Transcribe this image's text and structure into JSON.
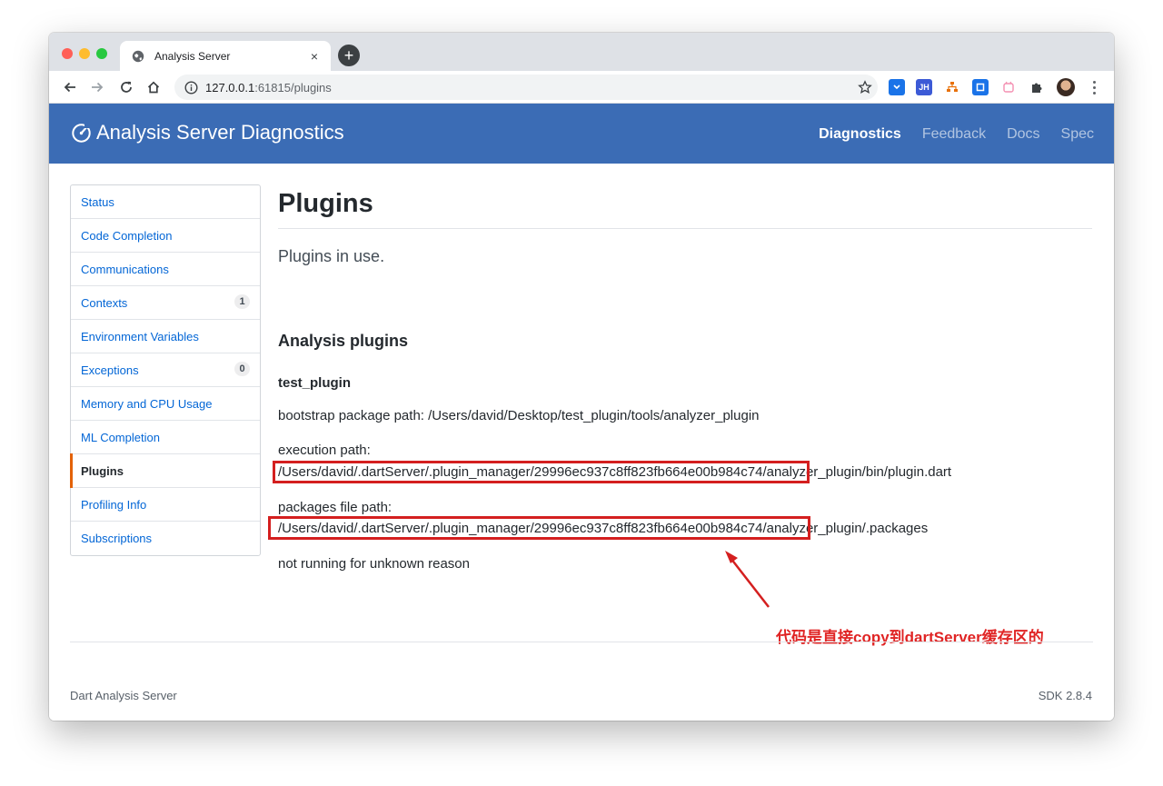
{
  "browser": {
    "tab_title": "Analysis Server",
    "new_tab_symbol": "+",
    "close_symbol": "×",
    "url_host": "127.0.0.1",
    "url_rest": ":61815/plugins",
    "extensions": [
      "JH"
    ]
  },
  "header": {
    "brand": "Analysis Server Diagnostics",
    "nav": {
      "diagnostics": "Diagnostics",
      "feedback": "Feedback",
      "docs": "Docs",
      "spec": "Spec"
    }
  },
  "sidebar": {
    "items": [
      {
        "label": "Status"
      },
      {
        "label": "Code Completion"
      },
      {
        "label": "Communications"
      },
      {
        "label": "Contexts",
        "count": "1"
      },
      {
        "label": "Environment Variables"
      },
      {
        "label": "Exceptions",
        "count": "0"
      },
      {
        "label": "Memory and CPU Usage"
      },
      {
        "label": "ML Completion"
      },
      {
        "label": "Plugins",
        "selected": true
      },
      {
        "label": "Profiling Info"
      },
      {
        "label": "Subscriptions"
      }
    ]
  },
  "main": {
    "title": "Plugins",
    "lead": "Plugins in use.",
    "section_title": "Analysis plugins",
    "plugin_name": "test_plugin",
    "bootstrap_line": "bootstrap package path: /Users/david/Desktop/test_plugin/tools/analyzer_plugin",
    "execution_label": "execution path:",
    "execution_path": "/Users/david/.dartServer/.plugin_manager/29996ec937c8ff823fb664e00b984c74/analyzer_plugin/bin/plugin.dart",
    "packages_label": "packages file path:",
    "packages_path": "/Users/david/.dartServer/.plugin_manager/29996ec937c8ff823fb664e00b984c74/analyzer_plugin/.packages",
    "status": "not running for unknown reason"
  },
  "annotation": {
    "text": "代码是直接copy到dartServer缓存区的",
    "color": "#e02424"
  },
  "footer": {
    "left": "Dart Analysis Server",
    "right": "SDK 2.8.4"
  },
  "colors": {
    "header_bg": "#3b6cb5",
    "link": "#0366d6",
    "selected_marker": "#e36209"
  }
}
